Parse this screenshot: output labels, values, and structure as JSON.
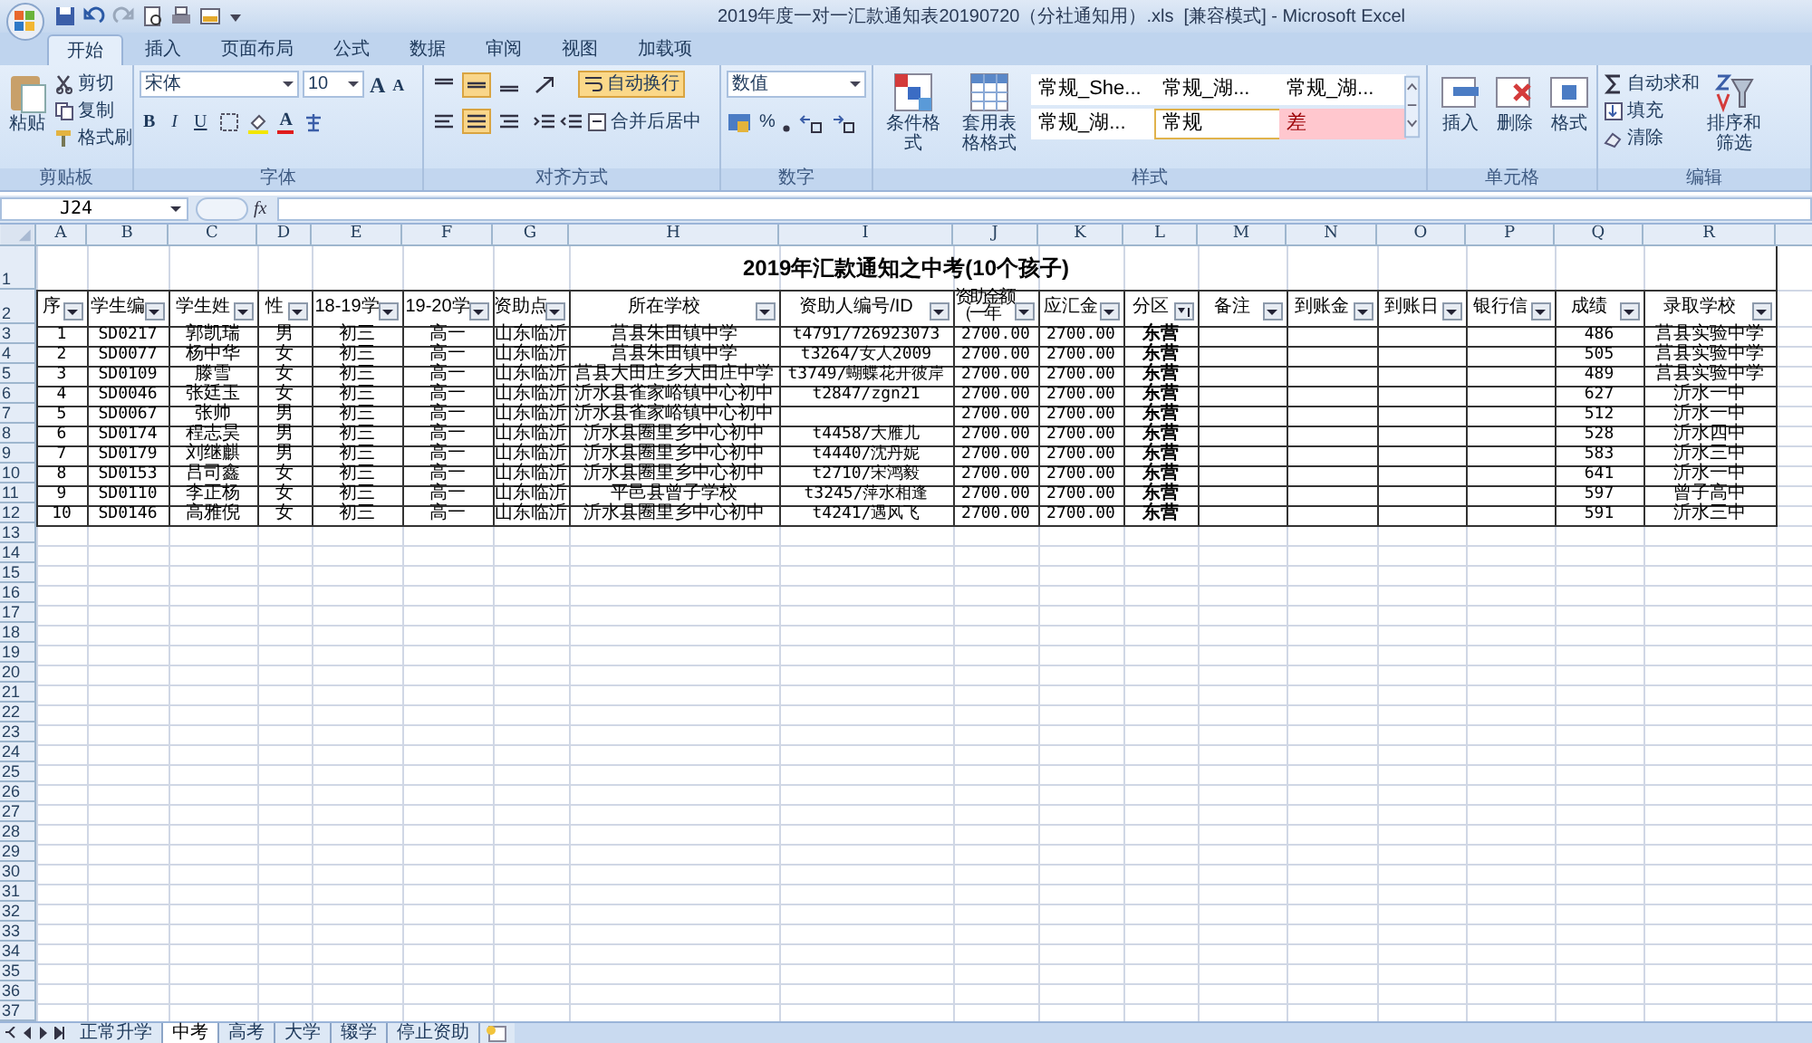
{
  "title_bar": {
    "title": "2019年度一对一汇款通知表20190720（分社通知用）.xls  [兼容模式] - Microsoft Excel"
  },
  "ribbon_tabs": [
    {
      "label": "开始",
      "selected": true
    },
    {
      "label": "插入",
      "selected": false
    },
    {
      "label": "页面布局",
      "selected": false
    },
    {
      "label": "公式",
      "selected": false
    },
    {
      "label": "数据",
      "selected": false
    },
    {
      "label": "审阅",
      "selected": false
    },
    {
      "label": "视图",
      "selected": false
    },
    {
      "label": "加载项",
      "selected": false
    }
  ],
  "ribbon": {
    "paste": "粘贴",
    "cut": "剪切",
    "copy": "复制",
    "format_painter": "格式刷",
    "clipboard_label": "剪贴板",
    "font_name": "宋体",
    "font_size": "10",
    "grow_font": "A",
    "shrink_font": "A",
    "bold": "B",
    "italic": "I",
    "underline": "U",
    "font_color": "A",
    "font_label": "字体",
    "wrap_text": "自动换行",
    "merge_center": "合并后居中",
    "alignment_label": "对齐方式",
    "number_format": "数值",
    "percent": "%",
    "number_label": "数字",
    "vertical_align": [
      {
        "selected": false
      },
      {
        "selected": true
      },
      {
        "selected": false
      }
    ],
    "horizontal_align": [
      {
        "selected": false
      },
      {
        "selected": true
      },
      {
        "selected": false
      }
    ],
    "conditional_format": "条件格式",
    "table_format": "套用表格格式",
    "styles_label": "样式",
    "cell_styles": [
      {
        "label": "常规_She...",
        "kind": "normal"
      },
      {
        "label": "常规_湖...",
        "kind": "normal"
      },
      {
        "label": "常规_湖...",
        "kind": "normal"
      },
      {
        "label": "常规_湖...",
        "kind": "normal"
      },
      {
        "label": "常规",
        "kind": "current"
      },
      {
        "label": "差",
        "kind": "bad"
      }
    ],
    "insert": "插入",
    "delete": "删除",
    "format": "格式",
    "cells_label": "单元格",
    "autosum": "自动求和",
    "fill": "填充",
    "clear": "清除",
    "sort_filter": "排序和筛选",
    "editing_label": "编辑"
  },
  "formula_bar": {
    "name_box": "J24",
    "fx": "fx"
  },
  "sheet": {
    "columns": [
      "A",
      "B",
      "C",
      "D",
      "E",
      "F",
      "G",
      "H",
      "I",
      "J",
      "K",
      "L",
      "M",
      "N",
      "O",
      "P",
      "Q",
      "R"
    ],
    "title_row": {
      "row": "1",
      "text": "2019年汇款通知之中考(10个孩子)"
    },
    "header_row": {
      "row": "2",
      "headers": [
        {
          "label": "序",
          "filter_applied": false,
          "wrapped": false
        },
        {
          "label": "学生编",
          "filter_applied": false,
          "wrapped": false
        },
        {
          "label": "学生姓",
          "filter_applied": false,
          "wrapped": false
        },
        {
          "label": "性",
          "filter_applied": false,
          "wrapped": false
        },
        {
          "label": "18-19学",
          "filter_applied": false,
          "wrapped": false
        },
        {
          "label": "19-20学",
          "filter_applied": false,
          "wrapped": false
        },
        {
          "label": "资助点",
          "filter_applied": false,
          "wrapped": false
        },
        {
          "label": "所在学校",
          "filter_applied": false,
          "wrapped": false
        },
        {
          "label": "资助人编号/ID",
          "filter_applied": false,
          "wrapped": false
        },
        {
          "label": "资助金额（一年",
          "filter_applied": false,
          "wrapped": true
        },
        {
          "label": "应汇金",
          "filter_applied": false,
          "wrapped": false
        },
        {
          "label": "分区",
          "filter_applied": true,
          "wrapped": false
        },
        {
          "label": "备注",
          "filter_applied": false,
          "wrapped": false
        },
        {
          "label": "到账金",
          "filter_applied": false,
          "wrapped": false
        },
        {
          "label": "到账日",
          "filter_applied": false,
          "wrapped": false
        },
        {
          "label": "银行信",
          "filter_applied": false,
          "wrapped": false
        },
        {
          "label": "成绩",
          "filter_applied": false,
          "wrapped": false
        },
        {
          "label": "录取学校",
          "filter_applied": false,
          "wrapped": false
        }
      ]
    },
    "rows": [
      {
        "row": "3",
        "cells": {
          "A": "1",
          "B": "SD0217",
          "C": "郭凯瑞",
          "D": "男",
          "E": "初三",
          "F": "高一",
          "G": "山东临沂",
          "H": "莒县朱田镇中学",
          "I": "t4791/726923073",
          "J": "2700.00",
          "K": "2700.00",
          "L": "东营",
          "Q": "486",
          "R": "莒县实验中学"
        }
      },
      {
        "row": "4",
        "cells": {
          "A": "2",
          "B": "SD0077",
          "C": "杨中华",
          "D": "女",
          "E": "初三",
          "F": "高一",
          "G": "山东临沂",
          "H": "莒县朱田镇中学",
          "I": "t3264/女人2009",
          "J": "2700.00",
          "K": "2700.00",
          "L": "东营",
          "Q": "505",
          "R": "莒县实验中学"
        }
      },
      {
        "row": "5",
        "cells": {
          "A": "3",
          "B": "SD0109",
          "C": "滕雪",
          "D": "女",
          "E": "初三",
          "F": "高一",
          "G": "山东临沂",
          "H": "莒县大田庄乡大田庄中学",
          "I": "t3749/蝴蝶花开彼岸",
          "J": "2700.00",
          "K": "2700.00",
          "L": "东营",
          "Q": "489",
          "R": "莒县实验中学"
        }
      },
      {
        "row": "6",
        "cells": {
          "A": "4",
          "B": "SD0046",
          "C": "张廷玉",
          "D": "女",
          "E": "初三",
          "F": "高一",
          "G": "山东临沂",
          "H": "沂水县雀家峪镇中心初中",
          "I": "t2847/zgn21",
          "J": "2700.00",
          "K": "2700.00",
          "L": "东营",
          "Q": "627",
          "R": "沂水一中"
        }
      },
      {
        "row": "7",
        "cells": {
          "A": "5",
          "B": "SD0067",
          "C": "张帅",
          "D": "男",
          "E": "初三",
          "F": "高一",
          "G": "山东临沂",
          "H": "沂水县雀家峪镇中心初中",
          "J": "2700.00",
          "K": "2700.00",
          "L": "东营",
          "Q": "512",
          "R": "沂水一中"
        }
      },
      {
        "row": "8",
        "cells": {
          "A": "6",
          "B": "SD0174",
          "C": "程志昊",
          "D": "男",
          "E": "初三",
          "F": "高一",
          "G": "山东临沂",
          "H": "沂水县圈里乡中心初中",
          "I": "t4458/大雁儿",
          "J": "2700.00",
          "K": "2700.00",
          "L": "东营",
          "Q": "528",
          "R": "沂水四中"
        }
      },
      {
        "row": "9",
        "cells": {
          "A": "7",
          "B": "SD0179",
          "C": "刘继麒",
          "D": "男",
          "E": "初三",
          "F": "高一",
          "G": "山东临沂",
          "H": "沂水县圈里乡中心初中",
          "I": "t4440/沈丹妮",
          "J": "2700.00",
          "K": "2700.00",
          "L": "东营",
          "Q": "583",
          "R": "沂水三中"
        }
      },
      {
        "row": "10",
        "cells": {
          "A": "8",
          "B": "SD0153",
          "C": "吕司鑫",
          "D": "女",
          "E": "初三",
          "F": "高一",
          "G": "山东临沂",
          "H": "沂水县圈里乡中心初中",
          "I": "t2710/宋鸿毅",
          "J": "2700.00",
          "K": "2700.00",
          "L": "东营",
          "Q": "641",
          "R": "沂水一中"
        }
      },
      {
        "row": "11",
        "cells": {
          "A": "9",
          "B": "SD0110",
          "C": "李正杨",
          "D": "女",
          "E": "初三",
          "F": "高一",
          "G": "山东临沂",
          "H": "平邑县曾子学校",
          "I": "t3245/萍水相逢",
          "J": "2700.00",
          "K": "2700.00",
          "L": "东营",
          "Q": "597",
          "R": "曾子高中"
        }
      },
      {
        "row": "12",
        "cells": {
          "A": "10",
          "B": "SD0146",
          "C": "高雅倪",
          "D": "女",
          "E": "初三",
          "F": "高一",
          "G": "山东临沂",
          "H": "沂水县圈里乡中心初中",
          "I": "t4241/遇风飞",
          "J": "2700.00",
          "K": "2700.00",
          "L": "东营",
          "Q": "591",
          "R": "沂水三中"
        }
      }
    ],
    "empty_rows": [
      "13",
      "14",
      "15",
      "16",
      "17",
      "18",
      "19",
      "20",
      "21",
      "22",
      "23",
      "24",
      "25",
      "26",
      "27",
      "28",
      "29",
      "30",
      "31",
      "32",
      "33",
      "34",
      "35",
      "36",
      "37"
    ]
  },
  "sheet_tabs": [
    {
      "label": "正常升学",
      "selected": false
    },
    {
      "label": "中考",
      "selected": true
    },
    {
      "label": "高考",
      "selected": false
    },
    {
      "label": "大学",
      "selected": false
    },
    {
      "label": "辍学",
      "selected": false
    },
    {
      "label": "停止资助",
      "selected": false
    }
  ]
}
